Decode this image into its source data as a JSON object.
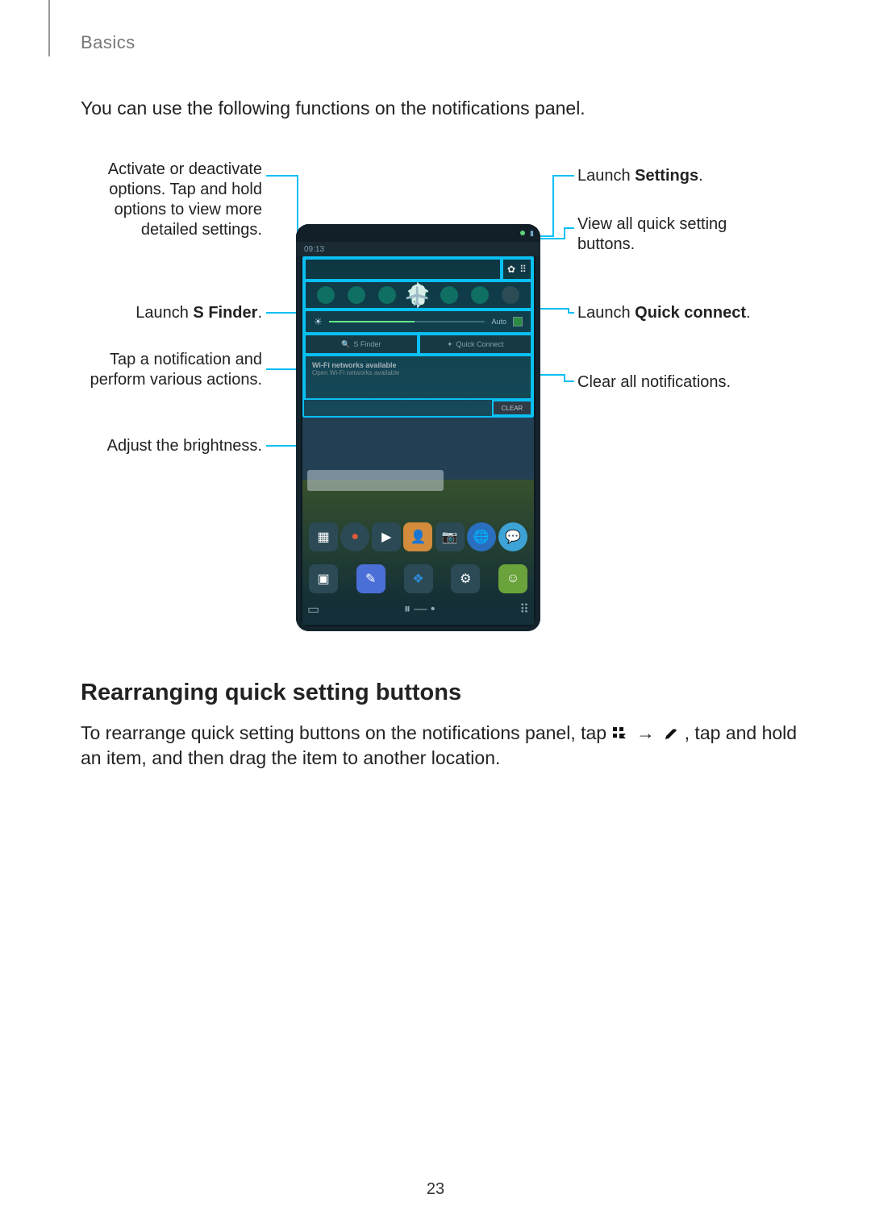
{
  "section": "Basics",
  "intro": "You can use the following functions on the notifications panel.",
  "callouts": {
    "left": {
      "toggles": "Activate or deactivate options. Tap and hold options to view more detailed settings.",
      "sfinder_pre": "Launch ",
      "sfinder_bold": "S Finder",
      "sfinder_post": ".",
      "notif": "Tap a notification and perform various actions.",
      "bright": "Adjust the brightness."
    },
    "right": {
      "settings_pre": "Launch ",
      "settings_bold": "Settings",
      "settings_post": ".",
      "grid": "View all quick setting buttons.",
      "qc_pre": "Launch ",
      "qc_bold": "Quick connect",
      "qc_post": ".",
      "clear": "Clear all notifications."
    }
  },
  "phone": {
    "status_time": "09:13",
    "gear_symbol": "✿",
    "grid_symbol": "⠿",
    "quick_icons": [
      "wifi",
      "location",
      "sound",
      "rotate",
      "bt",
      "share",
      "airplane"
    ],
    "sfinder_label": "S Finder",
    "qc_label": "Quick Connect",
    "notif_title": "Wi-Fi networks available",
    "notif_sub": "Open Wi-Fi networks available",
    "clear_label": "CLEAR"
  },
  "heading2": "Rearranging quick setting buttons",
  "para": {
    "a": "To rearrange quick setting buttons on the notifications panel, tap ",
    "arrow": "→",
    "b": ", tap and hold an item, and then drag the item to another location."
  },
  "page_number": "23"
}
